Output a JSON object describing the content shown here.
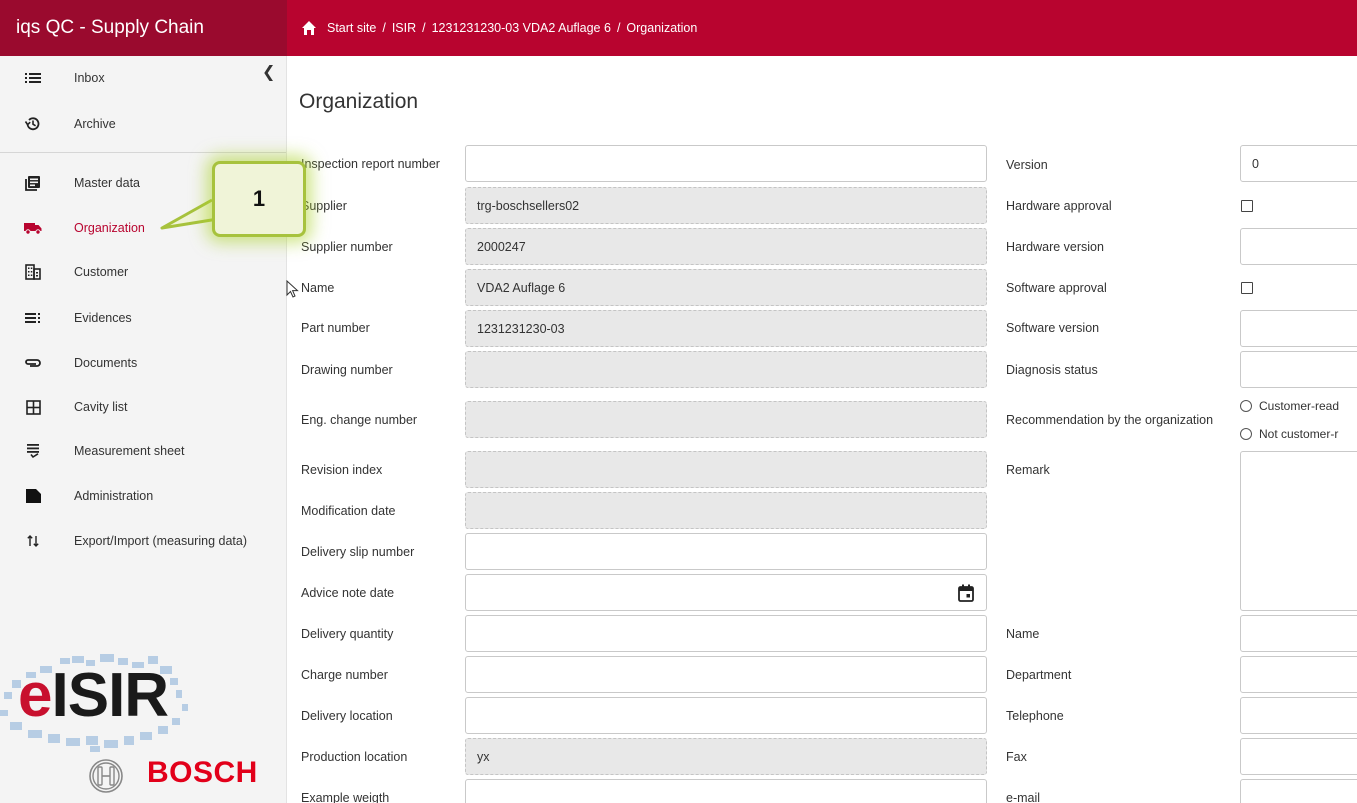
{
  "app": {
    "title": "iqs QC - Supply Chain"
  },
  "breadcrumb": [
    "Start site",
    "ISIR",
    "1231231230-03 VDA2 Auflage 6",
    "Organization"
  ],
  "sidebar": {
    "items": [
      {
        "label": "Inbox",
        "icon": "list-icon"
      },
      {
        "label": "Archive",
        "icon": "history-icon"
      },
      {
        "label": "Master data",
        "icon": "master-data-icon"
      },
      {
        "label": "Organization",
        "icon": "truck-icon",
        "active": true
      },
      {
        "label": "Customer",
        "icon": "building-icon"
      },
      {
        "label": "Evidences",
        "icon": "evidences-icon"
      },
      {
        "label": "Documents",
        "icon": "paperclip-icon"
      },
      {
        "label": "Cavity list",
        "icon": "grid-icon"
      },
      {
        "label": "Measurement sheet",
        "icon": "checklist-icon"
      },
      {
        "label": "Administration",
        "icon": "folder-icon"
      },
      {
        "label": "Export/Import (measuring data)",
        "icon": "import-export-icon"
      }
    ],
    "logo_text_e": "e",
    "logo_text_rest": "ISIR",
    "brand": "BOSCH"
  },
  "page": {
    "title": "Organization"
  },
  "left_form": {
    "fields": [
      {
        "label": "Inspection report number",
        "value": "",
        "readonly": false
      },
      {
        "label": "Supplier",
        "value": "trg-boschsellers02",
        "readonly": true
      },
      {
        "label": "Supplier number",
        "value": "2000247",
        "readonly": true
      },
      {
        "label": "Name",
        "value": "VDA2 Auflage 6",
        "readonly": true
      },
      {
        "label": "Part number",
        "value": "1231231230-03",
        "readonly": true
      },
      {
        "label": "Drawing number",
        "value": "",
        "readonly": true
      },
      {
        "label": "Eng. change number",
        "value": "",
        "readonly": true
      },
      {
        "label": "Revision index",
        "value": "",
        "readonly": true
      },
      {
        "label": "Modification date",
        "value": "",
        "readonly": true
      },
      {
        "label": "Delivery slip number",
        "value": "",
        "readonly": false
      },
      {
        "label": "Advice note date",
        "value": "",
        "readonly": false
      },
      {
        "label": "Delivery quantity",
        "value": "",
        "readonly": false
      },
      {
        "label": "Charge number",
        "value": "",
        "readonly": false
      },
      {
        "label": "Delivery location",
        "value": "",
        "readonly": false
      },
      {
        "label": "Production location",
        "value": "yx",
        "readonly": true
      },
      {
        "label": "Example weigth",
        "value": "",
        "readonly": false
      }
    ]
  },
  "right_form": {
    "version_label": "Version",
    "version_value": "0",
    "hardware_approval_label": "Hardware approval",
    "hardware_version_label": "Hardware version",
    "software_approval_label": "Software approval",
    "software_version_label": "Software version",
    "diagnosis_status_label": "Diagnosis status",
    "recommendation_label": "Recommendation by the organization",
    "recommendation_options": [
      "Customer-read",
      "Not customer-r"
    ],
    "remark_label": "Remark",
    "name_label": "Name",
    "department_label": "Department",
    "telephone_label": "Telephone",
    "fax_label": "Fax",
    "email_label": "e-mail"
  },
  "callout": {
    "number": "1"
  },
  "colors": {
    "brand_dark": "#9a0a2e",
    "brand": "#b8042f",
    "callout_border": "#a7c23d"
  }
}
